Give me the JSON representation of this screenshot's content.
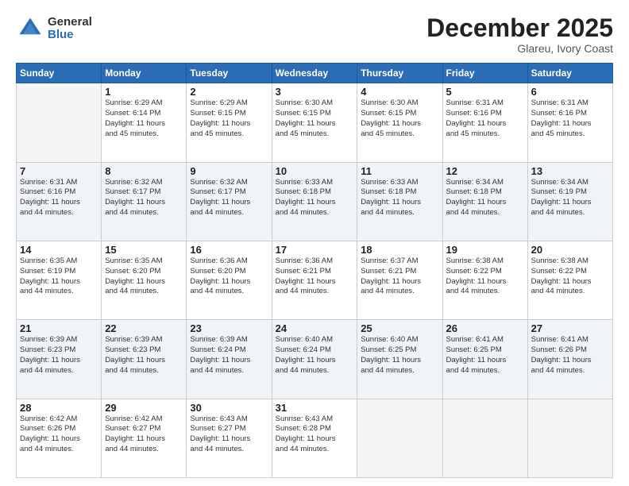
{
  "logo": {
    "general": "General",
    "blue": "Blue"
  },
  "header": {
    "month": "December 2025",
    "location": "Glareu, Ivory Coast"
  },
  "weekdays": [
    "Sunday",
    "Monday",
    "Tuesday",
    "Wednesday",
    "Thursday",
    "Friday",
    "Saturday"
  ],
  "weeks": [
    [
      {
        "day": "",
        "info": ""
      },
      {
        "day": "1",
        "info": "Sunrise: 6:29 AM\nSunset: 6:14 PM\nDaylight: 11 hours\nand 45 minutes."
      },
      {
        "day": "2",
        "info": "Sunrise: 6:29 AM\nSunset: 6:15 PM\nDaylight: 11 hours\nand 45 minutes."
      },
      {
        "day": "3",
        "info": "Sunrise: 6:30 AM\nSunset: 6:15 PM\nDaylight: 11 hours\nand 45 minutes."
      },
      {
        "day": "4",
        "info": "Sunrise: 6:30 AM\nSunset: 6:15 PM\nDaylight: 11 hours\nand 45 minutes."
      },
      {
        "day": "5",
        "info": "Sunrise: 6:31 AM\nSunset: 6:16 PM\nDaylight: 11 hours\nand 45 minutes."
      },
      {
        "day": "6",
        "info": "Sunrise: 6:31 AM\nSunset: 6:16 PM\nDaylight: 11 hours\nand 45 minutes."
      }
    ],
    [
      {
        "day": "7",
        "info": "Sunrise: 6:31 AM\nSunset: 6:16 PM\nDaylight: 11 hours\nand 44 minutes."
      },
      {
        "day": "8",
        "info": "Sunrise: 6:32 AM\nSunset: 6:17 PM\nDaylight: 11 hours\nand 44 minutes."
      },
      {
        "day": "9",
        "info": "Sunrise: 6:32 AM\nSunset: 6:17 PM\nDaylight: 11 hours\nand 44 minutes."
      },
      {
        "day": "10",
        "info": "Sunrise: 6:33 AM\nSunset: 6:18 PM\nDaylight: 11 hours\nand 44 minutes."
      },
      {
        "day": "11",
        "info": "Sunrise: 6:33 AM\nSunset: 6:18 PM\nDaylight: 11 hours\nand 44 minutes."
      },
      {
        "day": "12",
        "info": "Sunrise: 6:34 AM\nSunset: 6:18 PM\nDaylight: 11 hours\nand 44 minutes."
      },
      {
        "day": "13",
        "info": "Sunrise: 6:34 AM\nSunset: 6:19 PM\nDaylight: 11 hours\nand 44 minutes."
      }
    ],
    [
      {
        "day": "14",
        "info": "Sunrise: 6:35 AM\nSunset: 6:19 PM\nDaylight: 11 hours\nand 44 minutes."
      },
      {
        "day": "15",
        "info": "Sunrise: 6:35 AM\nSunset: 6:20 PM\nDaylight: 11 hours\nand 44 minutes."
      },
      {
        "day": "16",
        "info": "Sunrise: 6:36 AM\nSunset: 6:20 PM\nDaylight: 11 hours\nand 44 minutes."
      },
      {
        "day": "17",
        "info": "Sunrise: 6:36 AM\nSunset: 6:21 PM\nDaylight: 11 hours\nand 44 minutes."
      },
      {
        "day": "18",
        "info": "Sunrise: 6:37 AM\nSunset: 6:21 PM\nDaylight: 11 hours\nand 44 minutes."
      },
      {
        "day": "19",
        "info": "Sunrise: 6:38 AM\nSunset: 6:22 PM\nDaylight: 11 hours\nand 44 minutes."
      },
      {
        "day": "20",
        "info": "Sunrise: 6:38 AM\nSunset: 6:22 PM\nDaylight: 11 hours\nand 44 minutes."
      }
    ],
    [
      {
        "day": "21",
        "info": "Sunrise: 6:39 AM\nSunset: 6:23 PM\nDaylight: 11 hours\nand 44 minutes."
      },
      {
        "day": "22",
        "info": "Sunrise: 6:39 AM\nSunset: 6:23 PM\nDaylight: 11 hours\nand 44 minutes."
      },
      {
        "day": "23",
        "info": "Sunrise: 6:39 AM\nSunset: 6:24 PM\nDaylight: 11 hours\nand 44 minutes."
      },
      {
        "day": "24",
        "info": "Sunrise: 6:40 AM\nSunset: 6:24 PM\nDaylight: 11 hours\nand 44 minutes."
      },
      {
        "day": "25",
        "info": "Sunrise: 6:40 AM\nSunset: 6:25 PM\nDaylight: 11 hours\nand 44 minutes."
      },
      {
        "day": "26",
        "info": "Sunrise: 6:41 AM\nSunset: 6:25 PM\nDaylight: 11 hours\nand 44 minutes."
      },
      {
        "day": "27",
        "info": "Sunrise: 6:41 AM\nSunset: 6:26 PM\nDaylight: 11 hours\nand 44 minutes."
      }
    ],
    [
      {
        "day": "28",
        "info": "Sunrise: 6:42 AM\nSunset: 6:26 PM\nDaylight: 11 hours\nand 44 minutes."
      },
      {
        "day": "29",
        "info": "Sunrise: 6:42 AM\nSunset: 6:27 PM\nDaylight: 11 hours\nand 44 minutes."
      },
      {
        "day": "30",
        "info": "Sunrise: 6:43 AM\nSunset: 6:27 PM\nDaylight: 11 hours\nand 44 minutes."
      },
      {
        "day": "31",
        "info": "Sunrise: 6:43 AM\nSunset: 6:28 PM\nDaylight: 11 hours\nand 44 minutes."
      },
      {
        "day": "",
        "info": ""
      },
      {
        "day": "",
        "info": ""
      },
      {
        "day": "",
        "info": ""
      }
    ]
  ]
}
